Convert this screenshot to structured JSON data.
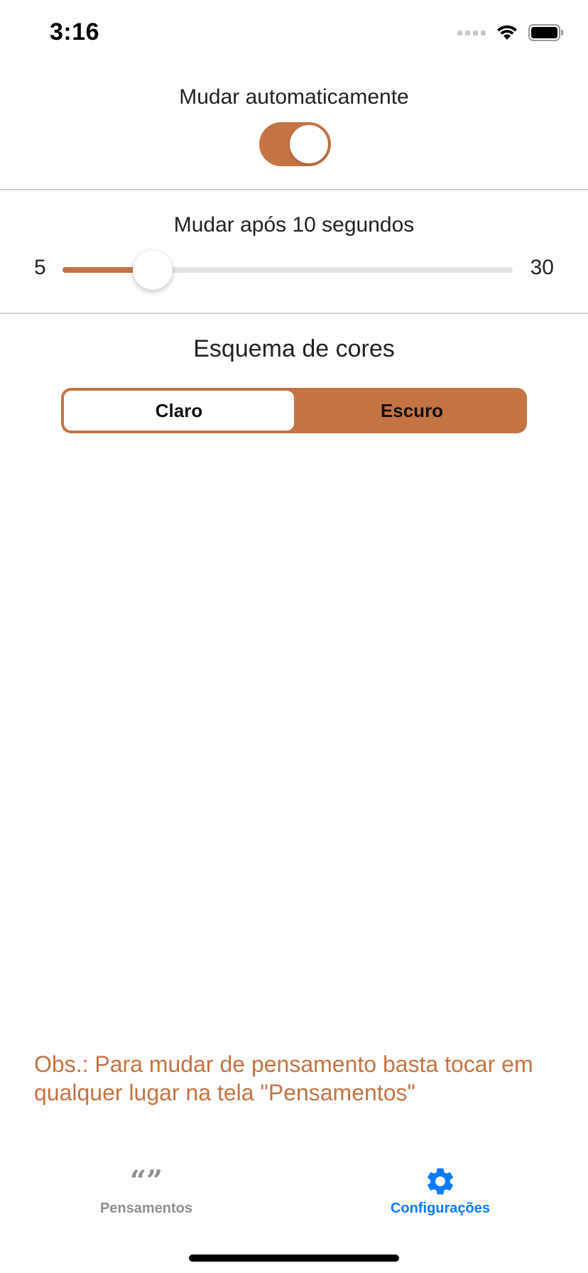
{
  "status_bar": {
    "time": "3:16",
    "icons": [
      "cellular-signal-icon",
      "wifi-icon",
      "battery-icon"
    ]
  },
  "auto_switch": {
    "label": "Mudar automaticamente",
    "enabled": true
  },
  "interval": {
    "label": "Mudar após 10 segundos",
    "min": "5",
    "max": "30",
    "value": 10
  },
  "color_scheme": {
    "label": "Esquema de cores",
    "options": [
      "Claro",
      "Escuro"
    ],
    "selected": "Claro"
  },
  "note": "Obs.: Para mudar de pensamento basta tocar em qualquer lugar na tela \"Pensamentos\"",
  "tab_bar": {
    "items": [
      {
        "label": "Pensamentos",
        "icon": "quote-icon",
        "active": false
      },
      {
        "label": "Configurações",
        "icon": "gear-icon",
        "active": true
      }
    ]
  },
  "colors": {
    "accent": "#c47443",
    "active_tab": "#0a7aff",
    "inactive_tab": "#8e8e93"
  }
}
